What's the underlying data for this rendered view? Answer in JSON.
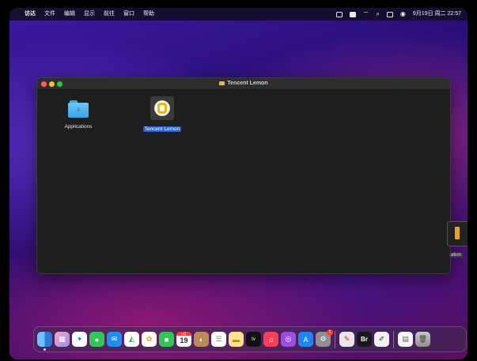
{
  "menubar": {
    "app_name": "访达",
    "items": [
      "文件",
      "编辑",
      "显示",
      "前往",
      "窗口",
      "帮助"
    ],
    "clock": "9月19日 周二  22:57"
  },
  "window": {
    "title": "Tencent Lemon",
    "items": [
      {
        "label": "Applications",
        "icon": "applications-folder-icon",
        "selected": false
      },
      {
        "label": "Tencent Lemon",
        "icon": "tencent-lemon-app-icon",
        "selected": true
      }
    ]
  },
  "desktop": {
    "partial_label": "ation"
  },
  "dock": {
    "calendar_month": "9月",
    "calendar_day": "19",
    "tv_label": "tv",
    "br_label": "Br",
    "badge_count": "1"
  },
  "colors": {
    "selection": "#2a62d9",
    "close": "#fe5f57",
    "minimize": "#febc2e",
    "maximize": "#28c840",
    "lemon": "#f5b400"
  }
}
